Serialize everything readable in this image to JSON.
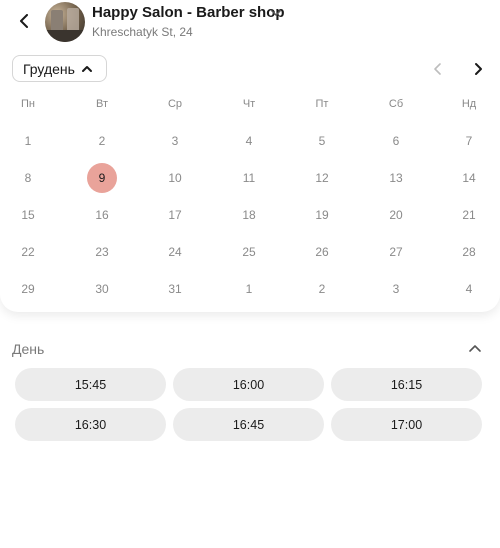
{
  "header": {
    "salon_name": "Happy Salon - Barber shop",
    "address": "Khreschatyk St, 24"
  },
  "calendar": {
    "month_label": "Грудень",
    "weekdays": [
      "Пн",
      "Вт",
      "Ср",
      "Чт",
      "Пт",
      "Сб",
      "Нд"
    ],
    "weeks": [
      [
        "1",
        "2",
        "3",
        "4",
        "5",
        "6",
        "7"
      ],
      [
        "8",
        "9",
        "10",
        "11",
        "12",
        "13",
        "14"
      ],
      [
        "15",
        "16",
        "17",
        "18",
        "19",
        "20",
        "21"
      ],
      [
        "22",
        "23",
        "24",
        "25",
        "26",
        "27",
        "28"
      ],
      [
        "29",
        "30",
        "31",
        "1",
        "2",
        "3",
        "4"
      ]
    ],
    "selected_day": "9",
    "colors": {
      "selected": "#e9a39a"
    }
  },
  "slots_section": {
    "label": "День",
    "times": [
      "15:45",
      "16:00",
      "16:15",
      "16:30",
      "16:45",
      "17:00"
    ]
  }
}
